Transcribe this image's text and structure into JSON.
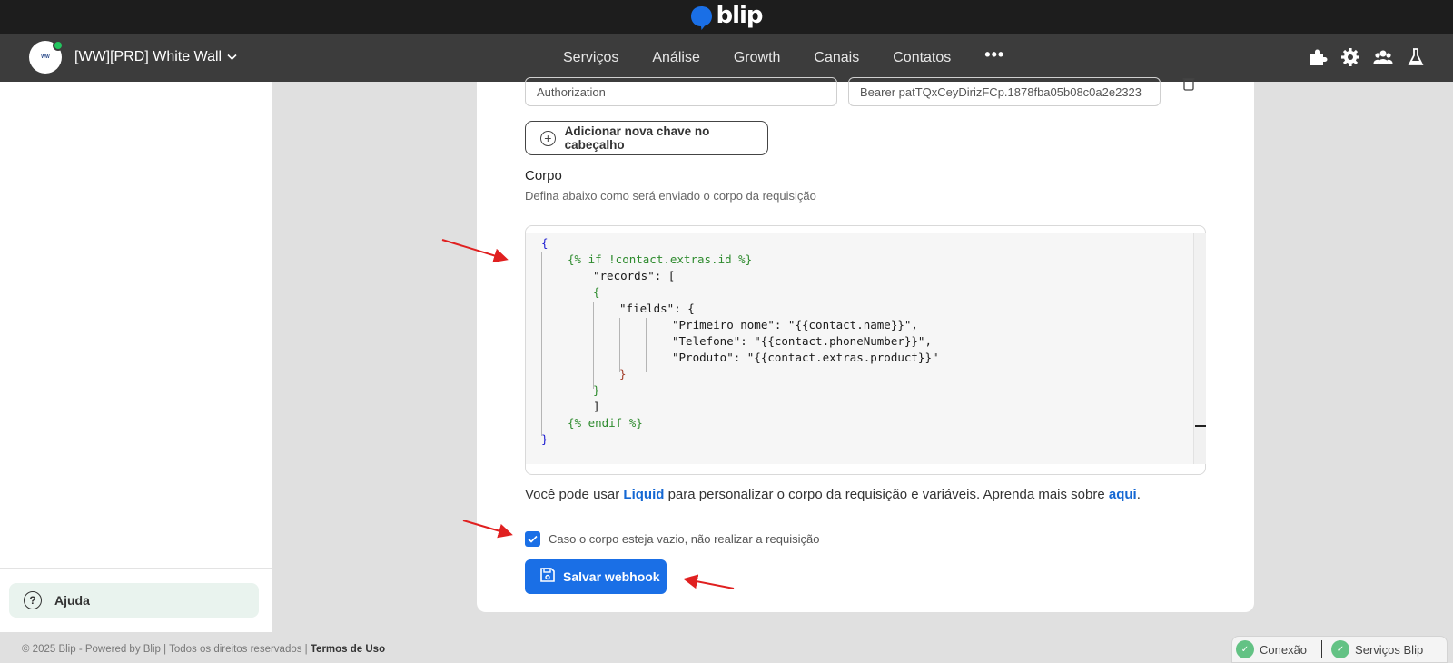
{
  "brand": {
    "name": "blip",
    "color": "#1a6fe6"
  },
  "nav": {
    "tenant_name": "[WW][PRD] White Wall",
    "tenant_status_color": "#22c55e",
    "links": [
      "Serviços",
      "Análise",
      "Growth",
      "Canais",
      "Contatos"
    ],
    "more": "•••",
    "icons": [
      "puzzle-icon",
      "gear-icon",
      "team-icon",
      "flask-icon"
    ]
  },
  "sidebar": {
    "help_label": "Ajuda"
  },
  "headers": {
    "key_value": "Authorization",
    "value_value": "Bearer patTQxCeyDirizFCp.1878fba05b08c0a2e2323",
    "add_label": "Adicionar nova chave no cabeçalho"
  },
  "body_section": {
    "title": "Corpo",
    "description": "Defina abaixo como será enviado o corpo da requisição",
    "code_lines": [
      "{",
      "{% if !contact.extras.id %}",
      "\"records\": [",
      "{",
      "\"fields\": {",
      "\"Primeiro nome\": \"{{contact.name}}\",",
      "\"Telefone\": \"{{contact.phoneNumber}}\",",
      "\"Produto\": \"{{contact.extras.product}}\"",
      "}",
      "}",
      "]",
      "{% endif %}",
      "}"
    ],
    "hint_prefix": "Você pode usar ",
    "hint_link1": "Liquid",
    "hint_middle": " para personalizar o corpo da requisição e variáveis. Aprenda mais sobre ",
    "hint_link2": "aqui",
    "hint_suffix": ".",
    "checkbox_label": "Caso o corpo esteja vazio, não realizar a requisição",
    "checkbox_checked": true,
    "save_label": "Salvar webhook"
  },
  "footer": {
    "copyright": "© 2025 Blip - Powered by Blip | Todos os direitos reservados | ",
    "terms": "Termos de Uso",
    "status_connection": "Conexão",
    "status_services": "Serviços Blip"
  }
}
